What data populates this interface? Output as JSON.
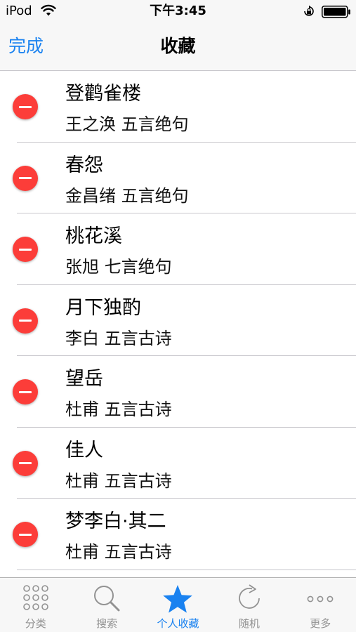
{
  "status_bar": {
    "carrier": "iPod",
    "time": "下午3:45"
  },
  "nav": {
    "done_label": "完成",
    "title": "收藏"
  },
  "favorites": [
    {
      "title": "登鹳雀楼",
      "subtitle": "王之涣 五言绝句"
    },
    {
      "title": "春怨",
      "subtitle": "金昌绪 五言绝句"
    },
    {
      "title": "桃花溪",
      "subtitle": "张旭 七言绝句"
    },
    {
      "title": "月下独酌",
      "subtitle": "李白 五言古诗"
    },
    {
      "title": "望岳",
      "subtitle": "杜甫 五言古诗"
    },
    {
      "title": "佳人",
      "subtitle": "杜甫 五言古诗"
    },
    {
      "title": "梦李白·其二",
      "subtitle": "杜甫 五言古诗"
    }
  ],
  "tabs": [
    {
      "label": "分类",
      "icon": "grid-icon"
    },
    {
      "label": "搜索",
      "icon": "search-icon"
    },
    {
      "label": "个人收藏",
      "icon": "star-icon",
      "active": true
    },
    {
      "label": "随机",
      "icon": "refresh-icon"
    },
    {
      "label": "更多",
      "icon": "more-icon"
    }
  ],
  "colors": {
    "accent": "#1a82f0",
    "delete": "#fc3d39",
    "inactive_tab": "#929292"
  }
}
